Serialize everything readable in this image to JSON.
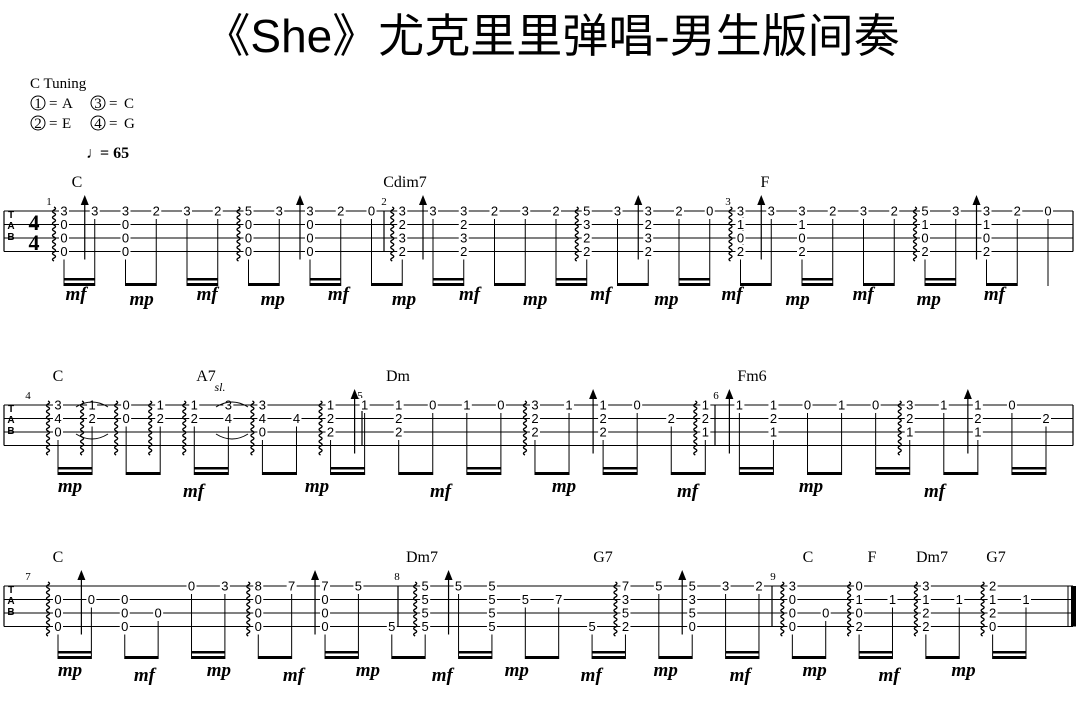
{
  "title": "《She》尤克里里弹唱-男生版间奏",
  "tuning": {
    "heading": "C Tuning",
    "strings": [
      {
        "num": "1",
        "note": "A"
      },
      {
        "num": "2",
        "note": "E"
      },
      {
        "num": "3",
        "note": "C"
      },
      {
        "num": "4",
        "note": "G"
      }
    ]
  },
  "tempo": {
    "symbol": "♩",
    "text": "= 65"
  },
  "time_signature": {
    "top": "4",
    "bottom": "4"
  },
  "tab_clef": [
    "T",
    "A",
    "B"
  ],
  "colors": {
    "ink": "#000000",
    "staff": "#000000",
    "background": "#ffffff"
  },
  "rows": [
    {
      "measure_numbers": [
        "1",
        "2",
        "3"
      ],
      "chords": [
        "C",
        "Cdim7",
        "F"
      ],
      "annotations": [],
      "beats": [
        {
          "frets": [
            "3",
            "0",
            "0",
            "0"
          ],
          "arp": true
        },
        {
          "frets": [
            "3",
            "",
            "",
            ""
          ],
          "up": true
        },
        {
          "frets": [
            "3",
            "0",
            "0",
            "0"
          ]
        },
        {
          "frets": [
            "2",
            "",
            "",
            ""
          ]
        },
        {
          "frets": [
            "3",
            "",
            "",
            ""
          ]
        },
        {
          "frets": [
            "2",
            "",
            "",
            ""
          ]
        },
        {
          "frets": [
            "5",
            "0",
            "0",
            "0"
          ],
          "arp": true
        },
        {
          "frets": [
            "3",
            "",
            "",
            ""
          ]
        },
        {
          "frets": [
            "3",
            "0",
            "0",
            "0"
          ],
          "up": true
        },
        {
          "frets": [
            "2",
            "",
            "",
            ""
          ]
        },
        {
          "frets": [
            "0",
            "",
            "",
            ""
          ]
        },
        {
          "frets": [
            "3",
            "2",
            "3",
            "2"
          ],
          "arp": true
        },
        {
          "frets": [
            "3",
            "",
            "",
            ""
          ],
          "up": true
        },
        {
          "frets": [
            "3",
            "2",
            "3",
            "2"
          ]
        },
        {
          "frets": [
            "2",
            "",
            "",
            ""
          ]
        },
        {
          "frets": [
            "3",
            "",
            "",
            ""
          ]
        },
        {
          "frets": [
            "2",
            "",
            "",
            ""
          ]
        },
        {
          "frets": [
            "5",
            "3",
            "2",
            "2"
          ],
          "arp": true
        },
        {
          "frets": [
            "3",
            "",
            "",
            ""
          ]
        },
        {
          "frets": [
            "3",
            "2",
            "3",
            "2"
          ],
          "up": true
        },
        {
          "frets": [
            "2",
            "",
            "",
            ""
          ]
        },
        {
          "frets": [
            "0",
            "",
            "",
            ""
          ]
        },
        {
          "frets": [
            "3",
            "1",
            "0",
            "2"
          ],
          "arp": true
        },
        {
          "frets": [
            "3",
            "",
            "",
            ""
          ],
          "up": true
        },
        {
          "frets": [
            "3",
            "1",
            "0",
            "2"
          ]
        },
        {
          "frets": [
            "2",
            "",
            "",
            ""
          ]
        },
        {
          "frets": [
            "3",
            "",
            "",
            ""
          ]
        },
        {
          "frets": [
            "2",
            "",
            "",
            ""
          ]
        },
        {
          "frets": [
            "5",
            "1",
            "0",
            "2"
          ],
          "arp": true
        },
        {
          "frets": [
            "3",
            "",
            "",
            ""
          ]
        },
        {
          "frets": [
            "3",
            "1",
            "0",
            "2"
          ],
          "up": true
        },
        {
          "frets": [
            "2",
            "",
            "",
            ""
          ]
        },
        {
          "frets": [
            "0",
            "",
            "",
            ""
          ]
        }
      ],
      "dynamics": [
        "mf",
        "mp",
        "mf",
        "mp",
        "mf",
        "mp",
        "mf",
        "mp",
        "mf",
        "mp",
        "mf",
        "mp",
        "mf",
        "mp",
        "mf"
      ]
    },
    {
      "measure_numbers": [
        "4",
        "5",
        "6"
      ],
      "chords": [
        "C",
        "A7",
        "Dm",
        "Fm6"
      ],
      "annotations": [
        "sl."
      ],
      "beats": [
        {
          "frets": [
            "3",
            "4",
            "0",
            ""
          ],
          "arp": true
        },
        {
          "frets": [
            "1",
            "2",
            "",
            ""
          ],
          "arp": true
        },
        {
          "frets": [
            "0",
            "0",
            "",
            ""
          ],
          "arp": true
        },
        {
          "frets": [
            "1",
            "2",
            "",
            ""
          ],
          "arp": true
        },
        {
          "frets": [
            "1",
            "2",
            "",
            ""
          ],
          "arp": true
        },
        {
          "frets": [
            "3",
            "4",
            "",
            ""
          ]
        },
        {
          "frets": [
            "3",
            "4",
            "0",
            ""
          ],
          "arp": true
        },
        {
          "frets": [
            "",
            "4",
            "",
            ""
          ]
        },
        {
          "frets": [
            "1",
            "2",
            "2",
            ""
          ],
          "arp": true
        },
        {
          "frets": [
            "1",
            "",
            "",
            ""
          ],
          "up": true
        },
        {
          "frets": [
            "1",
            "2",
            "2",
            ""
          ]
        },
        {
          "frets": [
            "0",
            "",
            "",
            ""
          ]
        },
        {
          "frets": [
            "1",
            "",
            "",
            ""
          ]
        },
        {
          "frets": [
            "0",
            "",
            "",
            ""
          ]
        },
        {
          "frets": [
            "3",
            "2",
            "2",
            ""
          ],
          "arp": true
        },
        {
          "frets": [
            "1",
            "",
            "",
            ""
          ]
        },
        {
          "frets": [
            "1",
            "2",
            "2",
            ""
          ],
          "up": true
        },
        {
          "frets": [
            "0",
            "",
            "",
            ""
          ]
        },
        {
          "frets": [
            "",
            "2",
            "",
            ""
          ]
        },
        {
          "frets": [
            "1",
            "2",
            "1",
            ""
          ],
          "arp": true
        },
        {
          "frets": [
            "1",
            "",
            "",
            ""
          ],
          "up": true
        },
        {
          "frets": [
            "1",
            "2",
            "1",
            ""
          ]
        },
        {
          "frets": [
            "0",
            "",
            "",
            ""
          ]
        },
        {
          "frets": [
            "1",
            "",
            "",
            ""
          ]
        },
        {
          "frets": [
            "0",
            "",
            "",
            ""
          ]
        },
        {
          "frets": [
            "3",
            "2",
            "1",
            ""
          ],
          "arp": true
        },
        {
          "frets": [
            "1",
            "",
            "",
            ""
          ]
        },
        {
          "frets": [
            "1",
            "2",
            "1",
            ""
          ],
          "up": true
        },
        {
          "frets": [
            "0",
            "",
            "",
            ""
          ]
        },
        {
          "frets": [
            "",
            "2",
            "",
            ""
          ]
        }
      ],
      "dynamics": [
        "mp",
        "mf",
        "mp",
        "mf",
        "mp",
        "mf",
        "mp",
        "mf"
      ]
    },
    {
      "measure_numbers": [
        "7",
        "8",
        "9"
      ],
      "chords": [
        "C",
        "Dm7",
        "G7",
        "C",
        "F",
        "Dm7",
        "G7"
      ],
      "annotations": [],
      "beats": [
        {
          "frets": [
            "",
            "0",
            "0",
            "0"
          ],
          "arp": true
        },
        {
          "frets": [
            "",
            "0",
            "",
            ""
          ],
          "up": true
        },
        {
          "frets": [
            "",
            "0",
            "0",
            "0"
          ]
        },
        {
          "frets": [
            "",
            "",
            "0",
            ""
          ]
        },
        {
          "frets": [
            "0",
            "",
            "",
            ""
          ]
        },
        {
          "frets": [
            "3",
            "",
            "",
            ""
          ]
        },
        {
          "frets": [
            "8",
            "0",
            "0",
            "0"
          ],
          "arp": true
        },
        {
          "frets": [
            "7",
            "",
            "",
            ""
          ]
        },
        {
          "frets": [
            "7",
            "0",
            "0",
            "0"
          ],
          "up": true
        },
        {
          "frets": [
            "5",
            "",
            "",
            ""
          ]
        },
        {
          "frets": [
            "",
            "",
            "",
            "5"
          ]
        },
        {
          "frets": [
            "5",
            "5",
            "5",
            "5"
          ],
          "arp": true
        },
        {
          "frets": [
            "5",
            "",
            "",
            ""
          ],
          "up": true
        },
        {
          "frets": [
            "5",
            "5",
            "5",
            "5"
          ]
        },
        {
          "frets": [
            "",
            "5",
            "",
            ""
          ]
        },
        {
          "frets": [
            "",
            "7",
            "",
            ""
          ]
        },
        {
          "frets": [
            "",
            "",
            "",
            "5"
          ]
        },
        {
          "frets": [
            "7",
            "3",
            "5",
            "2"
          ],
          "arp": true
        },
        {
          "frets": [
            "5",
            "",
            "",
            ""
          ]
        },
        {
          "frets": [
            "5",
            "3",
            "5",
            "0"
          ],
          "up": true
        },
        {
          "frets": [
            "3",
            "",
            "",
            ""
          ]
        },
        {
          "frets": [
            "2",
            "",
            "",
            ""
          ]
        },
        {
          "frets": [
            "3",
            "0",
            "0",
            "0"
          ],
          "arp": true
        },
        {
          "frets": [
            "",
            "",
            "0",
            ""
          ]
        },
        {
          "frets": [
            "0",
            "1",
            "0",
            "2"
          ],
          "arp": true
        },
        {
          "frets": [
            "",
            "1",
            "",
            ""
          ]
        },
        {
          "frets": [
            "3",
            "1",
            "2",
            "2"
          ],
          "arp": true
        },
        {
          "frets": [
            "",
            "1",
            "",
            ""
          ]
        },
        {
          "frets": [
            "2",
            "1",
            "2",
            "0"
          ],
          "arp": true
        },
        {
          "frets": [
            "",
            "1",
            "",
            ""
          ]
        }
      ],
      "dynamics": [
        "mp",
        "mf",
        "mp",
        "mf",
        "mp",
        "mf",
        "mp",
        "mf",
        "mp",
        "mf",
        "mp",
        "mf",
        "mp"
      ]
    }
  ]
}
